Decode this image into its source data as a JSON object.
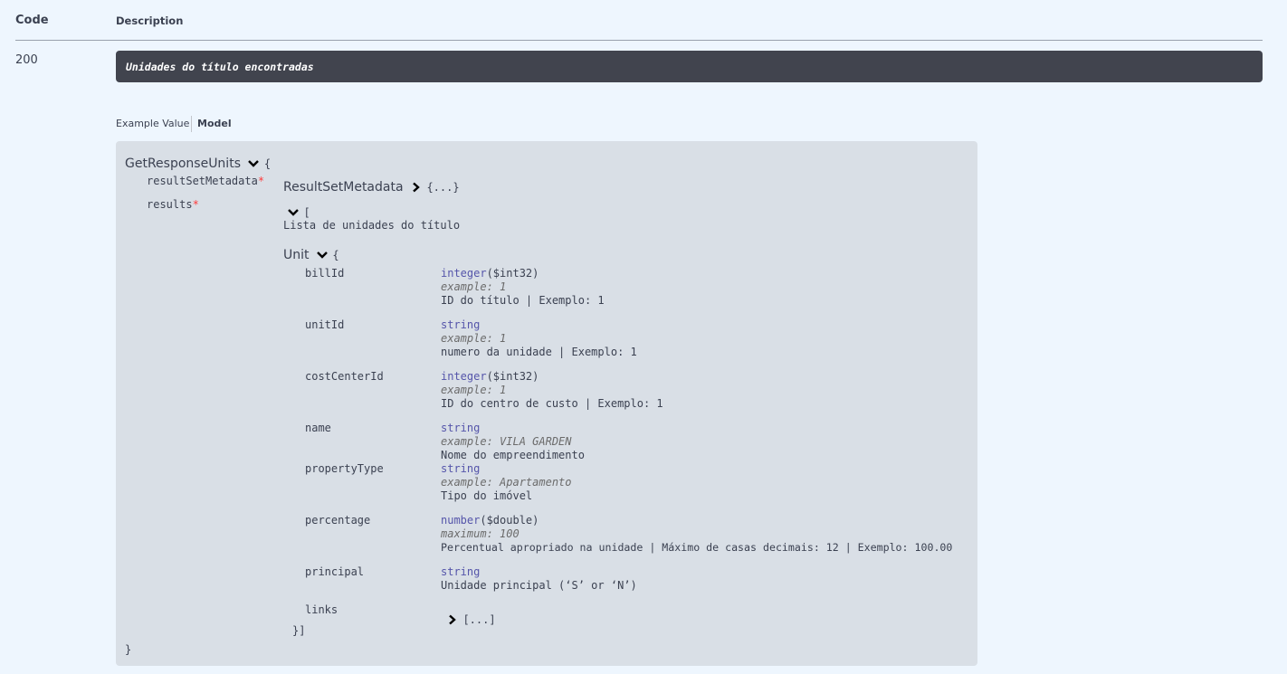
{
  "header": {
    "code_label": "Code",
    "description_label": "Description"
  },
  "response": {
    "code": "200",
    "description": "Unidades do título encontradas"
  },
  "tabs": {
    "example_value": "Example Value",
    "model": "Model"
  },
  "model": {
    "name": "GetResponseUnits",
    "open_brace": "{",
    "close_brace": "}",
    "props": {
      "resultSetMetadata": {
        "name": "resultSetMetadata",
        "required_mark": "*",
        "model_name": "ResultSetMetadata",
        "collapsed": "{...}"
      },
      "results": {
        "name": "results",
        "required_mark": "*",
        "array_open": "[",
        "description": "Lista de unidades do título",
        "item_model": "Unit",
        "item_open": "{",
        "close": "}]"
      }
    },
    "unit_fields": [
      {
        "name": "billId",
        "type": "integer",
        "format": "($int32)",
        "example": "example: 1",
        "description": "ID do título | Exemplo: 1"
      },
      {
        "name": "unitId",
        "type": "string",
        "format": "",
        "example": "example: 1",
        "description": "numero da unidade | Exemplo: 1"
      },
      {
        "name": "costCenterId",
        "type": "integer",
        "format": "($int32)",
        "example": "example: 1",
        "description": "ID do centro de custo | Exemplo: 1"
      },
      {
        "name": "name",
        "type": "string",
        "format": "",
        "example": "example: VILA GARDEN",
        "description": "Nome do empreendimento"
      },
      {
        "name": "propertyType",
        "type": "string",
        "format": "",
        "example": "example: Apartamento",
        "description": "Tipo do imóvel"
      },
      {
        "name": "percentage",
        "type": "number",
        "format": "($double)",
        "example": "maximum: 100",
        "description": "Percentual apropriado na unidade | Máximo de casas decimais: 12 | Exemplo: 100.00"
      },
      {
        "name": "principal",
        "type": "string",
        "format": "",
        "example": "",
        "description": "Unidade principal (‘S’ or ‘N’)"
      }
    ],
    "links": {
      "name": "links",
      "collapsed": "[...]"
    }
  },
  "icons": {
    "expanded": "chevron-down-icon",
    "collapsed": "chevron-right-icon"
  }
}
